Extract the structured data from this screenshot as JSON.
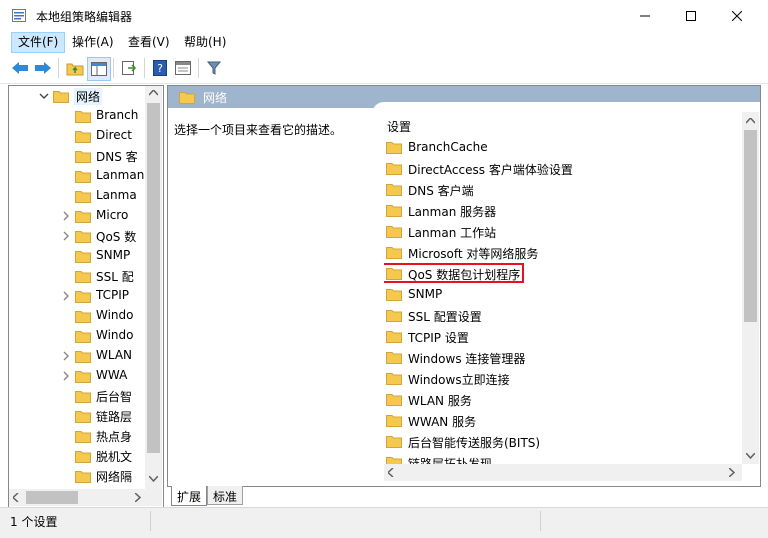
{
  "window": {
    "title": "本地组策略编辑器"
  },
  "menu": {
    "file": "文件(F)",
    "action": "操作(A)",
    "view": "查看(V)",
    "help": "帮助(H)"
  },
  "tree": {
    "items": [
      {
        "label": "网络",
        "expander": "open"
      },
      {
        "label": "Branch",
        "expander": "none"
      },
      {
        "label": "Direct",
        "expander": "none"
      },
      {
        "label": "DNS 客",
        "expander": "none"
      },
      {
        "label": "Lanman",
        "expander": "none"
      },
      {
        "label": "Lanma",
        "expander": "none"
      },
      {
        "label": "Micro",
        "expander": "closed"
      },
      {
        "label": "QoS 数",
        "expander": "closed"
      },
      {
        "label": "SNMP",
        "expander": "none"
      },
      {
        "label": "SSL 配",
        "expander": "none"
      },
      {
        "label": "TCPIP",
        "expander": "closed"
      },
      {
        "label": "Windo",
        "expander": "none"
      },
      {
        "label": "Windo",
        "expander": "none"
      },
      {
        "label": "WLAN",
        "expander": "closed"
      },
      {
        "label": "WWA",
        "expander": "closed"
      },
      {
        "label": "后台智",
        "expander": "none"
      },
      {
        "label": "链路层",
        "expander": "none"
      },
      {
        "label": "热点身",
        "expander": "none"
      },
      {
        "label": "脱机文",
        "expander": "none"
      },
      {
        "label": "网络隔",
        "expander": "none"
      }
    ]
  },
  "details": {
    "header": "网络",
    "description": "选择一个项目来查看它的描述。",
    "column_header": "设置",
    "items": [
      "BranchCache",
      "DirectAccess 客户端体验设置",
      "DNS 客户端",
      "Lanman 服务器",
      "Lanman 工作站",
      "Microsoft 对等网络服务",
      "QoS 数据包计划程序",
      "SNMP",
      "SSL 配置设置",
      "TCPIP 设置",
      "Windows 连接管理器",
      "Windows立即连接",
      "WLAN 服务",
      "WWAN 服务",
      "后台智能传送服务(BITS)",
      "链路层拓扑发现"
    ],
    "highlighted_index": 6,
    "highlight_color": "#e81123"
  },
  "tabs": {
    "extended": "扩展",
    "standard": "标准"
  },
  "status": {
    "text": "1 个设置"
  },
  "colors": {
    "header_bar": "#9fb4cd",
    "folder": "#f5c94e",
    "selected_menu": "#cce8ff"
  }
}
